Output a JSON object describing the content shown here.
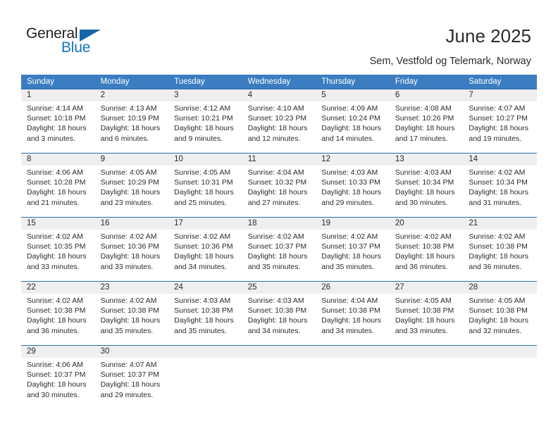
{
  "brand": {
    "name_part1": "General",
    "name_part2": "Blue",
    "triangle_icon": "brand-triangle-icon",
    "accent_blue": "#1277bf",
    "header_blue": "#3b7dc0",
    "separator_blue": "#2e6da4",
    "numberband_gray": "#efefef"
  },
  "header": {
    "title": "June 2025",
    "subtitle": "Sem, Vestfold og Telemark, Norway"
  },
  "calendar": {
    "weekday_headers": [
      "Sunday",
      "Monday",
      "Tuesday",
      "Wednesday",
      "Thursday",
      "Friday",
      "Saturday"
    ],
    "weeks": [
      {
        "numbers": [
          "1",
          "2",
          "3",
          "4",
          "5",
          "6",
          "7"
        ],
        "days": [
          {
            "sunrise": "Sunrise: 4:14 AM",
            "sunset": "Sunset: 10:18 PM",
            "daylight": "Daylight: 18 hours and 3 minutes."
          },
          {
            "sunrise": "Sunrise: 4:13 AM",
            "sunset": "Sunset: 10:19 PM",
            "daylight": "Daylight: 18 hours and 6 minutes."
          },
          {
            "sunrise": "Sunrise: 4:12 AM",
            "sunset": "Sunset: 10:21 PM",
            "daylight": "Daylight: 18 hours and 9 minutes."
          },
          {
            "sunrise": "Sunrise: 4:10 AM",
            "sunset": "Sunset: 10:23 PM",
            "daylight": "Daylight: 18 hours and 12 minutes."
          },
          {
            "sunrise": "Sunrise: 4:09 AM",
            "sunset": "Sunset: 10:24 PM",
            "daylight": "Daylight: 18 hours and 14 minutes."
          },
          {
            "sunrise": "Sunrise: 4:08 AM",
            "sunset": "Sunset: 10:26 PM",
            "daylight": "Daylight: 18 hours and 17 minutes."
          },
          {
            "sunrise": "Sunrise: 4:07 AM",
            "sunset": "Sunset: 10:27 PM",
            "daylight": "Daylight: 18 hours and 19 minutes."
          }
        ]
      },
      {
        "numbers": [
          "8",
          "9",
          "10",
          "11",
          "12",
          "13",
          "14"
        ],
        "days": [
          {
            "sunrise": "Sunrise: 4:06 AM",
            "sunset": "Sunset: 10:28 PM",
            "daylight": "Daylight: 18 hours and 21 minutes."
          },
          {
            "sunrise": "Sunrise: 4:05 AM",
            "sunset": "Sunset: 10:29 PM",
            "daylight": "Daylight: 18 hours and 23 minutes."
          },
          {
            "sunrise": "Sunrise: 4:05 AM",
            "sunset": "Sunset: 10:31 PM",
            "daylight": "Daylight: 18 hours and 25 minutes."
          },
          {
            "sunrise": "Sunrise: 4:04 AM",
            "sunset": "Sunset: 10:32 PM",
            "daylight": "Daylight: 18 hours and 27 minutes."
          },
          {
            "sunrise": "Sunrise: 4:03 AM",
            "sunset": "Sunset: 10:33 PM",
            "daylight": "Daylight: 18 hours and 29 minutes."
          },
          {
            "sunrise": "Sunrise: 4:03 AM",
            "sunset": "Sunset: 10:34 PM",
            "daylight": "Daylight: 18 hours and 30 minutes."
          },
          {
            "sunrise": "Sunrise: 4:02 AM",
            "sunset": "Sunset: 10:34 PM",
            "daylight": "Daylight: 18 hours and 31 minutes."
          }
        ]
      },
      {
        "numbers": [
          "15",
          "16",
          "17",
          "18",
          "19",
          "20",
          "21"
        ],
        "days": [
          {
            "sunrise": "Sunrise: 4:02 AM",
            "sunset": "Sunset: 10:35 PM",
            "daylight": "Daylight: 18 hours and 33 minutes."
          },
          {
            "sunrise": "Sunrise: 4:02 AM",
            "sunset": "Sunset: 10:36 PM",
            "daylight": "Daylight: 18 hours and 33 minutes."
          },
          {
            "sunrise": "Sunrise: 4:02 AM",
            "sunset": "Sunset: 10:36 PM",
            "daylight": "Daylight: 18 hours and 34 minutes."
          },
          {
            "sunrise": "Sunrise: 4:02 AM",
            "sunset": "Sunset: 10:37 PM",
            "daylight": "Daylight: 18 hours and 35 minutes."
          },
          {
            "sunrise": "Sunrise: 4:02 AM",
            "sunset": "Sunset: 10:37 PM",
            "daylight": "Daylight: 18 hours and 35 minutes."
          },
          {
            "sunrise": "Sunrise: 4:02 AM",
            "sunset": "Sunset: 10:38 PM",
            "daylight": "Daylight: 18 hours and 36 minutes."
          },
          {
            "sunrise": "Sunrise: 4:02 AM",
            "sunset": "Sunset: 10:38 PM",
            "daylight": "Daylight: 18 hours and 36 minutes."
          }
        ]
      },
      {
        "numbers": [
          "22",
          "23",
          "24",
          "25",
          "26",
          "27",
          "28"
        ],
        "days": [
          {
            "sunrise": "Sunrise: 4:02 AM",
            "sunset": "Sunset: 10:38 PM",
            "daylight": "Daylight: 18 hours and 36 minutes."
          },
          {
            "sunrise": "Sunrise: 4:02 AM",
            "sunset": "Sunset: 10:38 PM",
            "daylight": "Daylight: 18 hours and 35 minutes."
          },
          {
            "sunrise": "Sunrise: 4:03 AM",
            "sunset": "Sunset: 10:38 PM",
            "daylight": "Daylight: 18 hours and 35 minutes."
          },
          {
            "sunrise": "Sunrise: 4:03 AM",
            "sunset": "Sunset: 10:38 PM",
            "daylight": "Daylight: 18 hours and 34 minutes."
          },
          {
            "sunrise": "Sunrise: 4:04 AM",
            "sunset": "Sunset: 10:38 PM",
            "daylight": "Daylight: 18 hours and 34 minutes."
          },
          {
            "sunrise": "Sunrise: 4:05 AM",
            "sunset": "Sunset: 10:38 PM",
            "daylight": "Daylight: 18 hours and 33 minutes."
          },
          {
            "sunrise": "Sunrise: 4:05 AM",
            "sunset": "Sunset: 10:38 PM",
            "daylight": "Daylight: 18 hours and 32 minutes."
          }
        ]
      },
      {
        "numbers": [
          "29",
          "30",
          "",
          "",
          "",
          "",
          ""
        ],
        "days": [
          {
            "sunrise": "Sunrise: 4:06 AM",
            "sunset": "Sunset: 10:37 PM",
            "daylight": "Daylight: 18 hours and 30 minutes."
          },
          {
            "sunrise": "Sunrise: 4:07 AM",
            "sunset": "Sunset: 10:37 PM",
            "daylight": "Daylight: 18 hours and 29 minutes."
          },
          {
            "sunrise": "",
            "sunset": "",
            "daylight": ""
          },
          {
            "sunrise": "",
            "sunset": "",
            "daylight": ""
          },
          {
            "sunrise": "",
            "sunset": "",
            "daylight": ""
          },
          {
            "sunrise": "",
            "sunset": "",
            "daylight": ""
          },
          {
            "sunrise": "",
            "sunset": "",
            "daylight": ""
          }
        ]
      }
    ]
  }
}
